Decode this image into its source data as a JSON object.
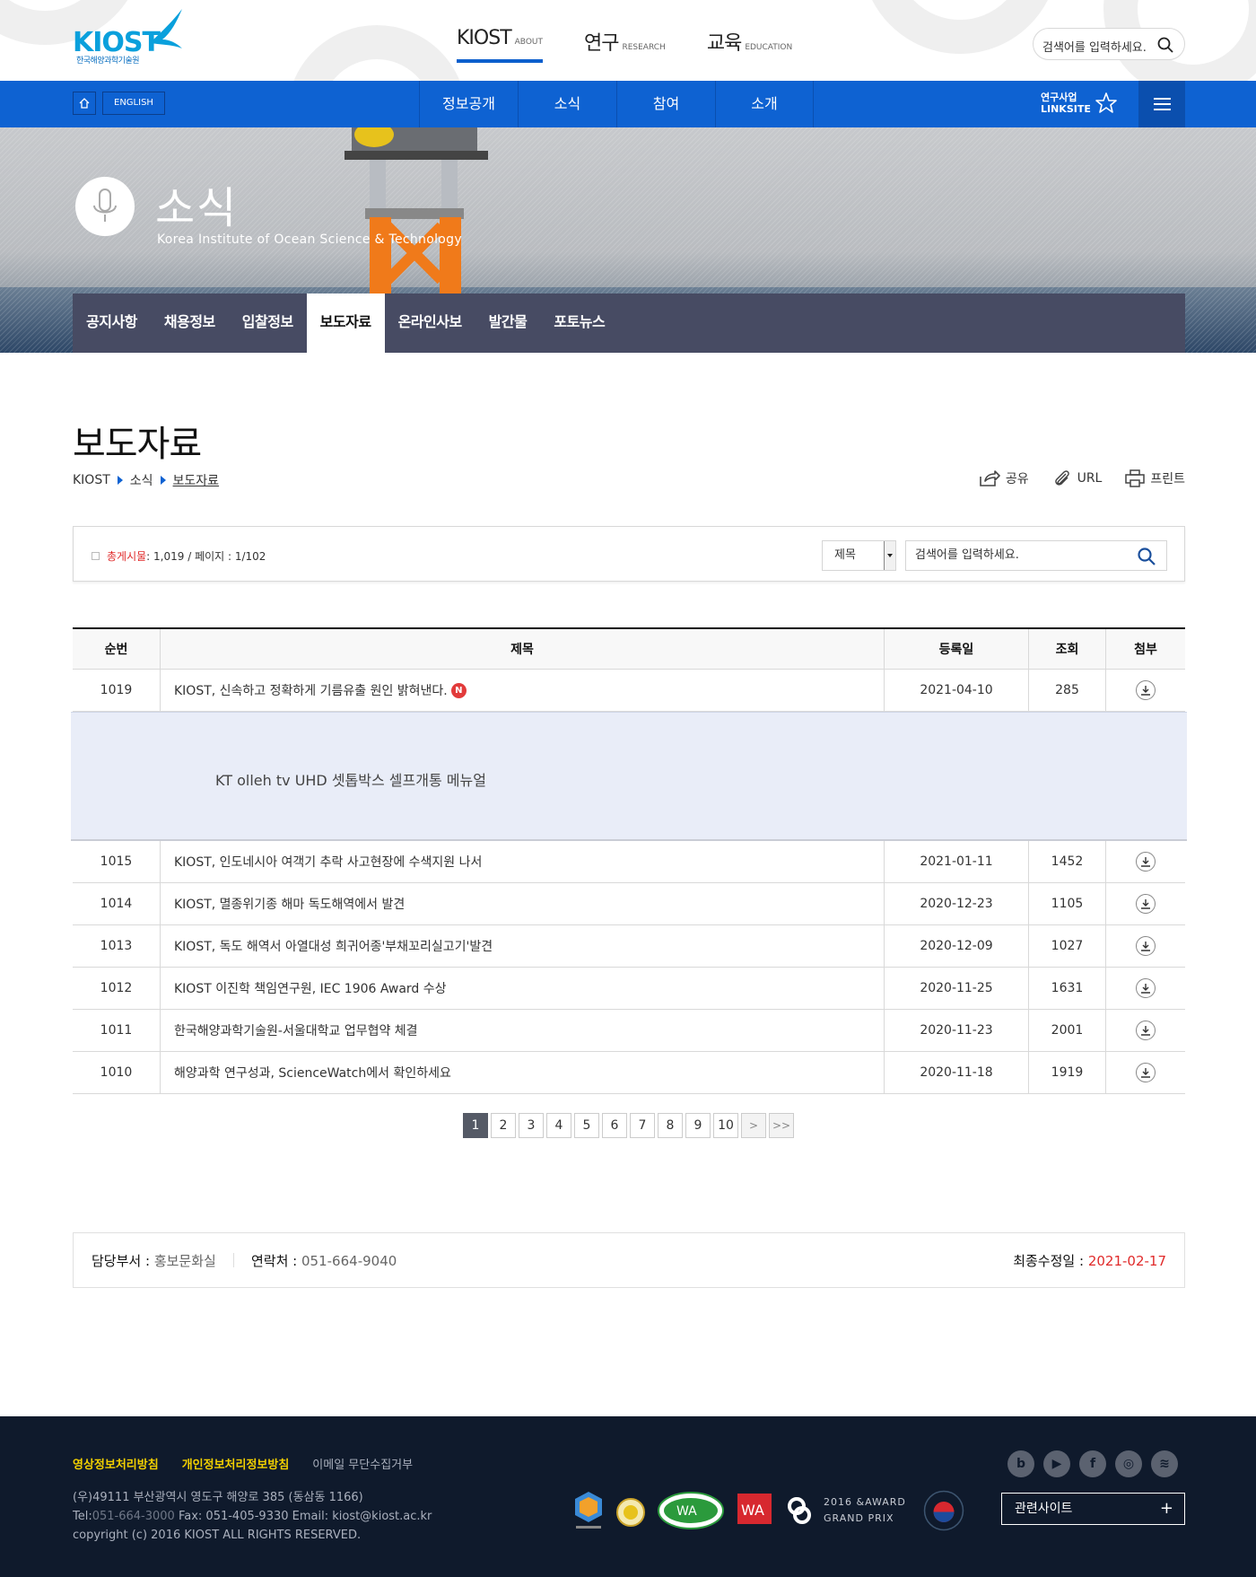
{
  "header": {
    "logo_text": "KIOST",
    "logo_sub": "한국해양과학기술원",
    "gnb": [
      {
        "ko": "KIOST",
        "en": "ABOUT"
      },
      {
        "ko": "연구",
        "en": "RESEARCH"
      },
      {
        "ko": "교육",
        "en": "EDUCATION"
      }
    ],
    "search_placeholder": "검색어를 입력하세요."
  },
  "bluenav": {
    "english": "ENGLISH",
    "menu": [
      "정보공개",
      "소식",
      "참여",
      "소개"
    ],
    "linksite_line1": "연구사업",
    "linksite_line2": "LINKSITE"
  },
  "hero": {
    "title": "소식",
    "subtitle": "Korea Institute of Ocean Science & Technology",
    "subnav": [
      "공지사항",
      "채용정보",
      "입찰정보",
      "보도자료",
      "온라인사보",
      "발간물",
      "포토뉴스"
    ]
  },
  "page": {
    "title": "보도자료",
    "breadcrumb": [
      "KIOST",
      "소식",
      "보도자료"
    ],
    "tools": {
      "share": "공유",
      "url": "URL",
      "print": "프린트"
    }
  },
  "search": {
    "total_label": "총게시물",
    "total_rest": " : 1,019 / 페이지 : 1/102",
    "select_value": "제목",
    "placeholder": "검색어를 입력하세요."
  },
  "table": {
    "headers": [
      "순번",
      "제목",
      "등록일",
      "조회",
      "첨부"
    ],
    "first_row": {
      "no": "1019",
      "title": "KIOST, 신속하고 정확하게 기름유출 원인 밝혀낸다.",
      "badge": "N",
      "date": "2021-04-10",
      "views": "285"
    },
    "ad_text": "KT olleh tv UHD 셋톱박스 셀프개통 메뉴얼",
    "rows": [
      {
        "no": "1015",
        "title": "KIOST, 인도네시아 여객기 추락 사고현장에 수색지원 나서",
        "date": "2021-01-11",
        "views": "1452"
      },
      {
        "no": "1014",
        "title": "KIOST, 멸종위기종 해마 독도해역에서 발견",
        "date": "2020-12-23",
        "views": "1105"
      },
      {
        "no": "1013",
        "title": "KIOST, 독도 해역서 아열대성 희귀어종'부채꼬리실고기'발견",
        "date": "2020-12-09",
        "views": "1027"
      },
      {
        "no": "1012",
        "title": "KIOST 이진학 책임연구원, IEC 1906 Award 수상",
        "date": "2020-11-25",
        "views": "1631"
      },
      {
        "no": "1011",
        "title": "한국해양과학기술원-서울대학교 업무협약 체결",
        "date": "2020-11-23",
        "views": "2001"
      },
      {
        "no": "1010",
        "title": "해양과학 연구성과, ScienceWatch에서 확인하세요",
        "date": "2020-11-18",
        "views": "1919"
      }
    ]
  },
  "pagination": {
    "pages": [
      "1",
      "2",
      "3",
      "4",
      "5",
      "6",
      "7",
      "8",
      "9",
      "10"
    ],
    "current": "1",
    "next": ">",
    "last": ">>"
  },
  "manager": {
    "dept_label": "담당부서 :",
    "dept": "홍보문화실",
    "contact_label": "연락처 :",
    "contact": "051-664-9040",
    "updated_label": "최종수정일 :",
    "updated": "2021-02-17"
  },
  "footer": {
    "links": [
      "영상정보처리방침",
      "개인정보처리정보방침",
      "이메일 무단수집거부"
    ],
    "address": "(우)49111 부산광역시 영도구 해양로 385 (동삼동 1166)",
    "tel_label": "Tel:",
    "tel": "051-664-3000",
    "fax_email": " Fax: 051-405-9330 Email: kiost@kiost.ac.kr",
    "copyright": "copyright (c) 2016 KIOST ALL RIGHTS RESERVED.",
    "award_line1": "2016 &AWARD",
    "award_line2": "GRAND PRIX",
    "related": "관련사이트",
    "social": [
      "blog-icon",
      "youtube-icon",
      "facebook-icon",
      "instagram-icon",
      "rss-icon"
    ]
  }
}
